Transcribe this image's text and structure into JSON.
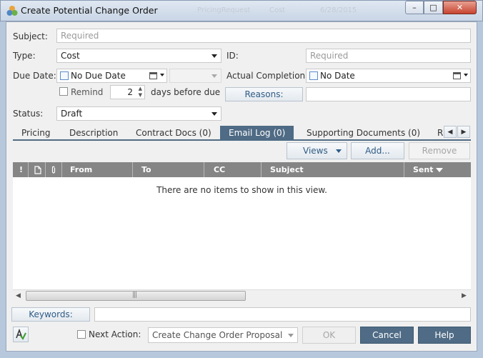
{
  "window": {
    "title": "Create Potential Change Order",
    "ghost_fields": [
      "PricingRequest",
      "Cost",
      "6/28/2015"
    ],
    "buttons": {
      "minimize": "–",
      "maximize": "□",
      "close": "✕"
    }
  },
  "form": {
    "subject": {
      "label": "Subject:",
      "placeholder": "Required"
    },
    "type": {
      "label": "Type:",
      "value": "Cost"
    },
    "id": {
      "label": "ID:",
      "placeholder": "Required"
    },
    "due_date": {
      "label": "Due Date:",
      "value": "No Due Date",
      "time_value": ""
    },
    "actual_completion": {
      "label": "Actual Completion:",
      "value": "No Date"
    },
    "remind": {
      "label": "Remind",
      "days": "2",
      "suffix": "days before due"
    },
    "reasons": {
      "button": "Reasons:",
      "value": ""
    },
    "status": {
      "label": "Status:",
      "value": "Draft"
    }
  },
  "tabs": [
    {
      "label": "Pricing",
      "active": false
    },
    {
      "label": "Description",
      "active": false
    },
    {
      "label": "Contract Docs (0)",
      "active": false
    },
    {
      "label": "Email Log (0)",
      "active": true
    },
    {
      "label": "Supporting Documents (0)",
      "active": false
    },
    {
      "label": "R",
      "active": false
    }
  ],
  "toolbar": {
    "views": "Views",
    "add": "Add...",
    "remove": "Remove"
  },
  "grid": {
    "columns": [
      "!",
      "",
      "",
      "From",
      "To",
      "CC",
      "Subject",
      "Sent"
    ],
    "sort_column": "Sent",
    "sort_direction": "descending",
    "empty_message": "There are no items to show in this view."
  },
  "footer": {
    "keywords_button": "Keywords:",
    "keywords_value": "",
    "next_action_label": "Next Action:",
    "next_action_value": "Create Change Order Proposal",
    "ok": "OK",
    "cancel": "Cancel",
    "help": "Help"
  },
  "colors": {
    "accent": "#4f6b85",
    "grid_header": "#858585",
    "link_button_text": "#2e5b86"
  }
}
